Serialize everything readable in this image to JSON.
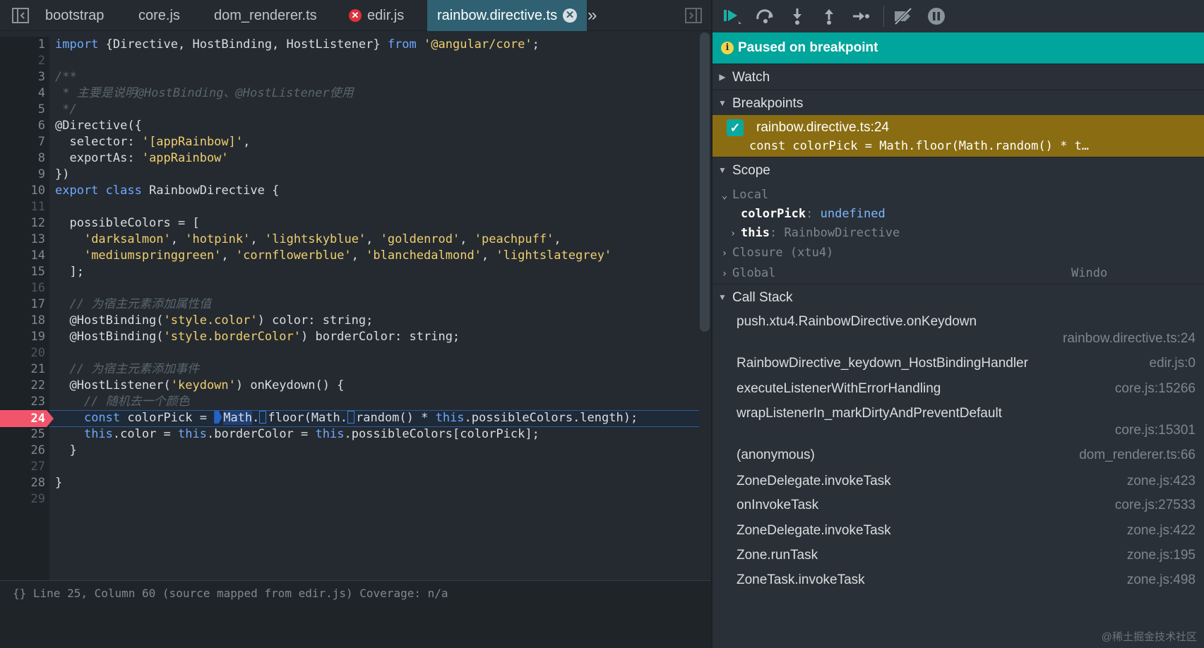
{
  "editor": {
    "tabs": [
      {
        "label": "bootstrap"
      },
      {
        "label": "core.js"
      },
      {
        "label": "dom_renderer.ts"
      },
      {
        "label": "edir.js",
        "error": true
      },
      {
        "label": "rainbow.directive.ts",
        "active": true
      }
    ],
    "more_tabs_glyph": "»",
    "breakpoint_line": "24",
    "lines": [
      {
        "n": "1"
      },
      {
        "n": "2"
      },
      {
        "n": "3"
      },
      {
        "n": "4"
      },
      {
        "n": "5"
      },
      {
        "n": "6"
      },
      {
        "n": "7"
      },
      {
        "n": "8"
      },
      {
        "n": "9"
      },
      {
        "n": "10"
      },
      {
        "n": "11"
      },
      {
        "n": "12"
      },
      {
        "n": "13"
      },
      {
        "n": "14"
      },
      {
        "n": "15"
      },
      {
        "n": "16"
      },
      {
        "n": "17"
      },
      {
        "n": "18"
      },
      {
        "n": "19"
      },
      {
        "n": "20"
      },
      {
        "n": "21"
      },
      {
        "n": "22"
      },
      {
        "n": "23"
      },
      {
        "n": "24"
      },
      {
        "n": "25"
      },
      {
        "n": "26"
      },
      {
        "n": "27"
      },
      {
        "n": "28"
      },
      {
        "n": "29"
      }
    ],
    "code": {
      "l1": {
        "a": "import",
        "b": " {Directive, HostBinding, HostListener} ",
        "c": "from",
        "d": " ",
        "e": "'@angular/core'",
        "f": ";"
      },
      "l3": "/**",
      "l4": " * 主要是说明@HostBinding、@HostListener使用",
      "l5": " */",
      "l6": "@Directive({",
      "l7": {
        "a": "  selector: ",
        "b": "'[appRainbow]'",
        "c": ","
      },
      "l8": {
        "a": "  exportAs: ",
        "b": "'appRainbow'"
      },
      "l9": "})",
      "l10": {
        "a": "export",
        "b": " ",
        "c": "class",
        "d": " RainbowDirective {"
      },
      "l12": "  possibleColors = [",
      "l13": {
        "pre": "    ",
        "s1": "'darksalmon'",
        "s2": "'hotpink'",
        "s3": "'lightskyblue'",
        "s4": "'goldenrod'",
        "s5": "'peachpuff'",
        "sep": ", ",
        "end": ","
      },
      "l14": {
        "pre": "    ",
        "s1": "'mediumspringgreen'",
        "s2": "'cornflowerblue'",
        "s3": "'blanchedalmond'",
        "s4": "'lightslategrey'",
        "sep": ", "
      },
      "l15": "  ];",
      "l17": "  // 为宿主元素添加属性值",
      "l18": {
        "a": "  @HostBinding(",
        "b": "'style.color'",
        "c": ") color: string;"
      },
      "l19": {
        "a": "  @HostBinding(",
        "b": "'style.borderColor'",
        "c": ") borderColor: string;"
      },
      "l21": "  // 为宿主元素添加事件",
      "l22": {
        "a": "  @HostListener(",
        "b": "'keydown'",
        "c": ") onKeydown() {"
      },
      "l23": "    // 随机去一个颜色",
      "l24": {
        "pre": "    ",
        "const": "const",
        "b": " colorPick = ",
        "math": "Math",
        "dot": ".",
        "floor": "floor(Math.",
        "rand": "random() * ",
        "this": "this",
        "rest": ".possibleColors.length);"
      },
      "l25": {
        "pre": "    ",
        "t1": "this",
        "b": ".color = ",
        "t2": "this",
        "c": ".borderColor = ",
        "t3": "this",
        "d": ".possibleColors[colorPick];"
      },
      "l26": "  }",
      "l28": "}"
    },
    "status": "{}   Line 25, Column 60  (source mapped from edir.js)  Coverage: n/a"
  },
  "debugger": {
    "paused_label": "Paused on breakpoint",
    "info_glyph": "i",
    "sections": {
      "watch": "Watch",
      "breakpoints": "Breakpoints",
      "scope": "Scope",
      "call_stack": "Call Stack"
    },
    "breakpoint": {
      "file": "rainbow.directive.ts:24",
      "code": "const colorPick = Math.floor(Math.random() * t…",
      "checked_glyph": "✓"
    },
    "scope": {
      "local": "Local",
      "colorPick_name": "colorPick",
      "colorPick_value": "undefined",
      "this_name": "this",
      "this_value": "RainbowDirective",
      "closure": "Closure (xtu4)",
      "global": "Global",
      "global_value": "Windo"
    },
    "call_stack": [
      {
        "fn": "push.xtu4.RainbowDirective.onKeydown",
        "loc": "rainbow.directive.ts:24"
      },
      {
        "fn": "RainbowDirective_keydown_HostBindingHandler",
        "loc": "edir.js:0"
      },
      {
        "fn": "executeListenerWithErrorHandling",
        "loc": "core.js:15266"
      },
      {
        "fn": "wrapListenerIn_markDirtyAndPreventDefault",
        "loc": "core.js:15301"
      },
      {
        "fn": "(anonymous)",
        "loc": "dom_renderer.ts:66"
      },
      {
        "fn": "ZoneDelegate.invokeTask",
        "loc": "zone.js:423"
      },
      {
        "fn": "onInvokeTask",
        "loc": "core.js:27533"
      },
      {
        "fn": "ZoneDelegate.invokeTask",
        "loc": "zone.js:422"
      },
      {
        "fn": "Zone.runTask",
        "loc": "zone.js:195"
      },
      {
        "fn": "ZoneTask.invokeTask",
        "loc": "zone.js:498"
      }
    ],
    "watermark": "@稀土掘金技术社区"
  },
  "colors": {
    "accent": "#00a59b",
    "breakpoint": "#f2556b",
    "breakpoint_item": "#8a6d12",
    "keyword": "#6fa8ff",
    "string": "#f1ce6f"
  }
}
